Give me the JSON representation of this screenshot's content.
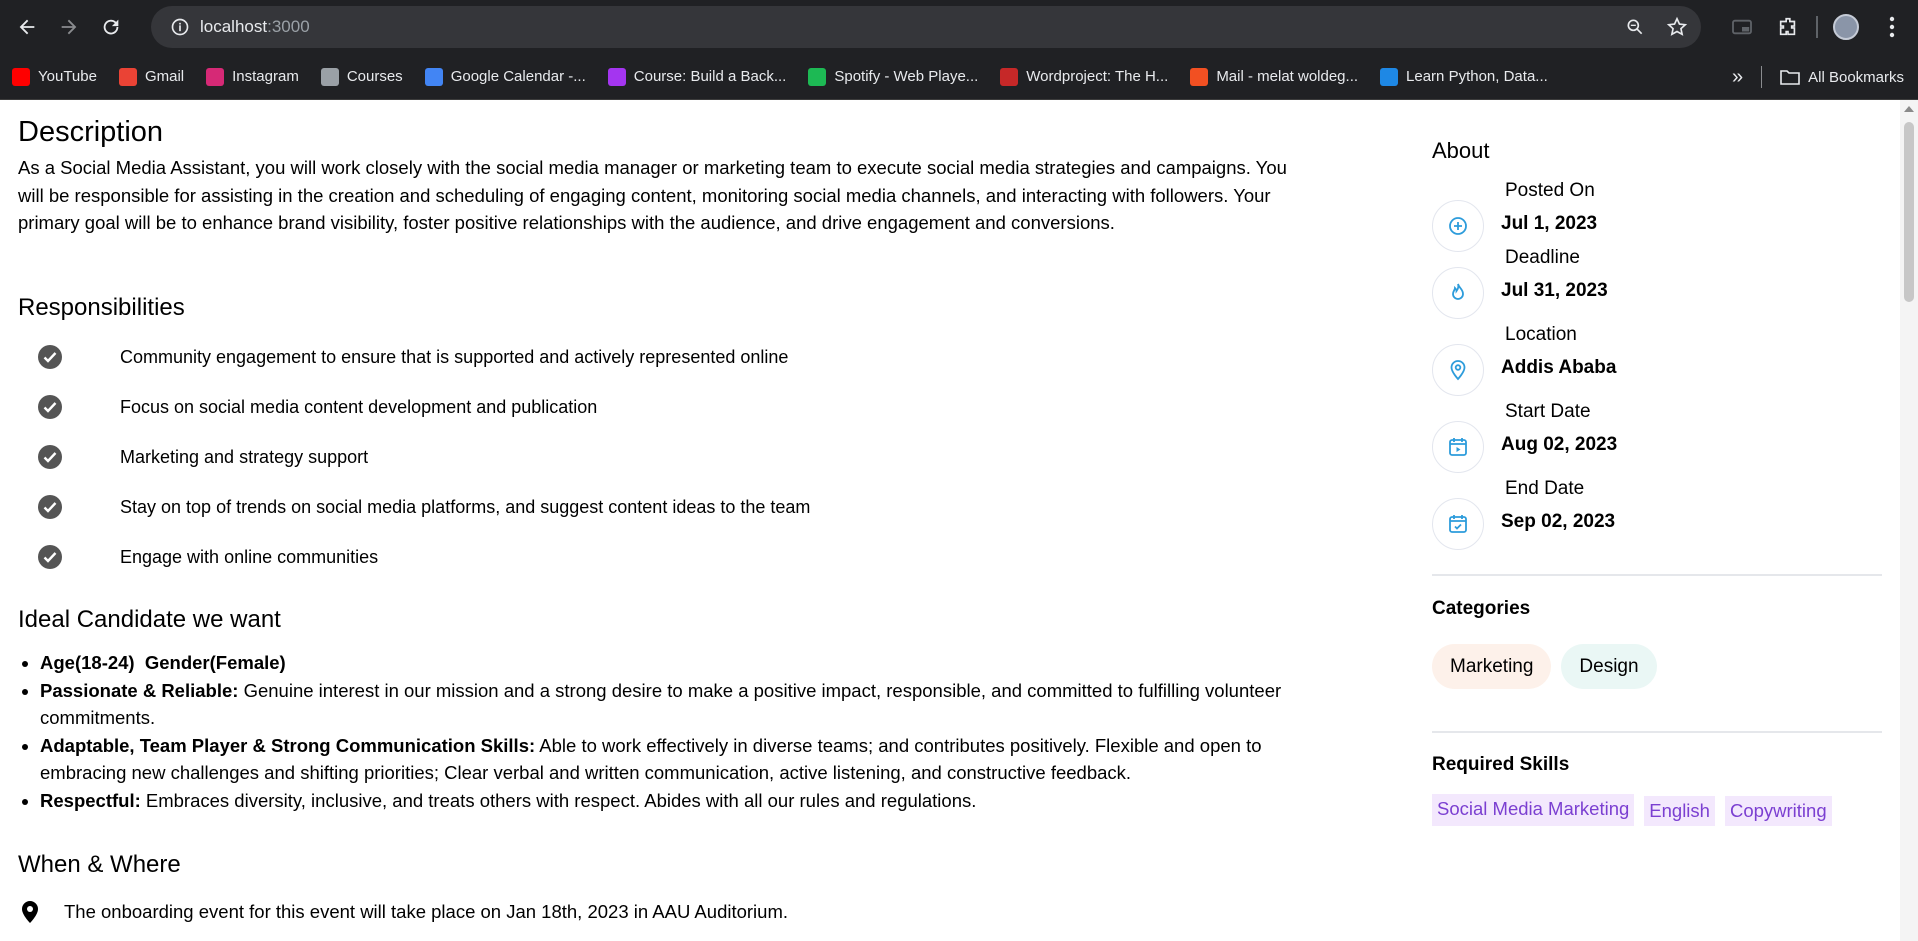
{
  "browser": {
    "url_host": "localhost",
    "url_port": ":3000",
    "bookmarks": [
      {
        "label": "YouTube",
        "color": "#ff0000",
        "icon": "youtube-icon"
      },
      {
        "label": "Gmail",
        "color": "#ea4335",
        "icon": "gmail-icon"
      },
      {
        "label": "Instagram",
        "color": "#d62976",
        "icon": "instagram-icon"
      },
      {
        "label": "Courses",
        "color": "#9aa0a6",
        "icon": "rocket-icon"
      },
      {
        "label": "Google Calendar -...",
        "color": "#4285f4",
        "icon": "calendar-icon"
      },
      {
        "label": "Course: Build a Back...",
        "color": "#a435f0",
        "icon": "udemy-icon"
      },
      {
        "label": "Spotify - Web Playe...",
        "color": "#1db954",
        "icon": "spotify-icon"
      },
      {
        "label": "Wordproject: The H...",
        "color": "#c62828",
        "icon": "wordproject-icon"
      },
      {
        "label": "Mail - melat woldeg...",
        "color": "#f25022",
        "icon": "microsoft-icon"
      },
      {
        "label": "Learn Python, Data...",
        "color": "#1e88e5",
        "icon": "k-icon"
      }
    ],
    "all_bookmarks": "All Bookmarks"
  },
  "description": {
    "title": "Description",
    "text": "As a Social Media Assistant, you will work closely with the social media manager or marketing team to execute social media strategies and campaigns. You will be responsible for assisting in the creation and scheduling of engaging content, monitoring social media channels, and interacting with followers. Your primary goal will be to enhance brand visibility, foster positive relationships with the audience, and drive engagement and conversions."
  },
  "responsibilities": {
    "title": "Responsibilities",
    "items": [
      "Community engagement to ensure that is supported and actively represented online",
      "Focus on social media content development and publication",
      "Marketing and strategy support",
      "Stay on top of trends on social media platforms, and suggest content ideas to the team",
      "Engage with online communities"
    ]
  },
  "ideal": {
    "title": "Ideal Candidate we want",
    "item0": "Age(18-24)  Gender(Female)",
    "items": [
      {
        "bold": "Passionate & Reliable:",
        "text": " Genuine interest in our mission and a strong desire to make a positive impact, responsible, and committed to fulfilling volunteer commitments."
      },
      {
        "bold": "Adaptable, Team Player & Strong Communication Skills:",
        "text": " Able to work effectively in diverse teams; and contributes positively. Flexible and open to embracing new challenges and shifting priorities; Clear verbal and written communication, active listening, and constructive feedback."
      },
      {
        "bold": "Respectful:",
        "text": " Embraces diversity, inclusive, and treats others with respect. Abides with all our rules and regulations."
      }
    ]
  },
  "when_where": {
    "title": "When & Where",
    "text": "The onboarding event for this event will take place on Jan 18th, 2023 in AAU Auditorium."
  },
  "about": {
    "title": "About",
    "rows": [
      {
        "label": "Posted On",
        "value": "Jul 1, 2023",
        "icon": "plus-circle-icon"
      },
      {
        "label": "Deadline",
        "value": "Jul 31, 2023",
        "icon": "fire-icon"
      },
      {
        "label": "Location",
        "value": "Addis Ababa",
        "icon": "location-pin-icon"
      },
      {
        "label": "Start Date",
        "value": "Aug 02, 2023",
        "icon": "calendar-play-icon"
      },
      {
        "label": "End Date",
        "value": "Sep 02, 2023",
        "icon": "calendar-check-icon"
      }
    ]
  },
  "categories": {
    "title": "Categories",
    "items": [
      {
        "label": "Marketing",
        "bg": "#fdf1ea"
      },
      {
        "label": "Design",
        "bg": "#eaf7f5"
      }
    ]
  },
  "skills": {
    "title": "Required Skills",
    "items": [
      "Social Media Marketing",
      "English",
      "Copywriting"
    ]
  },
  "colors": {
    "accent_blue": "#2d9cdb",
    "skill_text": "#7b3fd1",
    "skill_bg": "#f3e8fd"
  }
}
